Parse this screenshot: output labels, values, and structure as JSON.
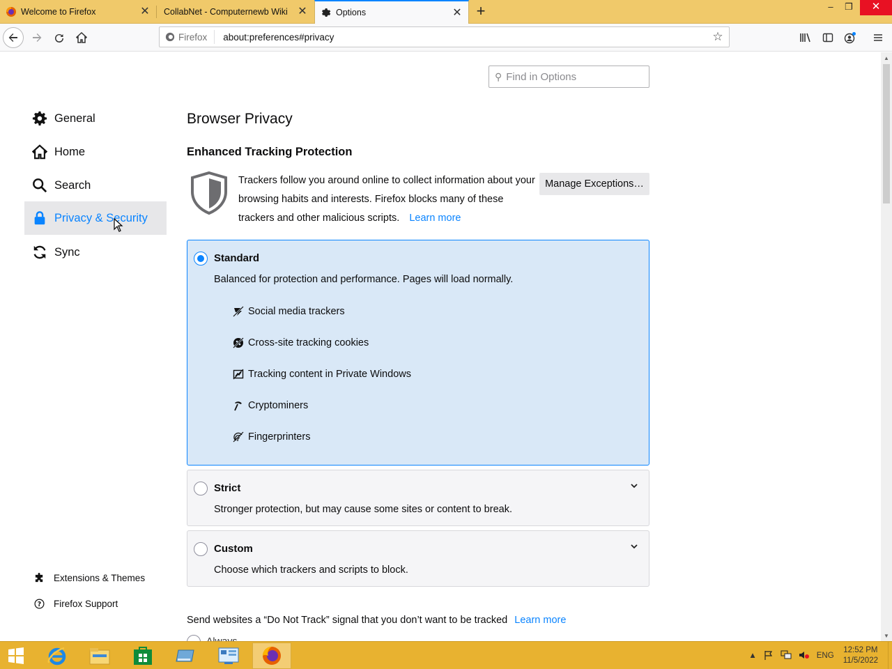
{
  "tabs": [
    {
      "title": "Welcome to Firefox",
      "icon": "firefox-icon"
    },
    {
      "title": "CollabNet - Computernewb Wiki",
      "icon": "none"
    },
    {
      "title": "Options",
      "icon": "gear-icon"
    }
  ],
  "window_controls": {
    "minimize": "–",
    "restore": "❐",
    "close": "✕"
  },
  "navbar": {
    "identity_label": "Firefox",
    "url": "about:preferences#privacy"
  },
  "search": {
    "placeholder": "Find in Options"
  },
  "sidebar": {
    "categories": [
      {
        "label": "General",
        "icon": "gear-icon"
      },
      {
        "label": "Home",
        "icon": "home-icon"
      },
      {
        "label": "Search",
        "icon": "search-icon"
      },
      {
        "label": "Privacy & Security",
        "icon": "lock-icon",
        "selected": true
      },
      {
        "label": "Sync",
        "icon": "sync-icon"
      }
    ],
    "footer": [
      {
        "label": "Extensions & Themes",
        "icon": "puzzle-icon"
      },
      {
        "label": "Firefox Support",
        "icon": "help-icon"
      }
    ]
  },
  "main": {
    "section_title": "Browser Privacy",
    "etp_heading": "Enhanced Tracking Protection",
    "etp_description": "Trackers follow you around online to collect information about your browsing habits and interests. Firefox blocks many of these trackers and other malicious scripts.",
    "learn_more": "Learn more",
    "manage_exceptions": "Manage Exceptions…",
    "options": {
      "standard": {
        "title": "Standard",
        "description": "Balanced for protection and performance. Pages will load normally.",
        "checked": true,
        "trackers": [
          {
            "label": "Social media trackers",
            "icon": "social-tracker-icon"
          },
          {
            "label": "Cross-site tracking cookies",
            "icon": "cookie-icon"
          },
          {
            "label": "Tracking content in Private Windows",
            "icon": "tracking-content-icon"
          },
          {
            "label": "Cryptominers",
            "icon": "cryptominer-icon"
          },
          {
            "label": "Fingerprinters",
            "icon": "fingerprint-icon"
          }
        ]
      },
      "strict": {
        "title": "Strict",
        "description": "Stronger protection, but may cause some sites or content to break.",
        "checked": false
      },
      "custom": {
        "title": "Custom",
        "description": "Choose which trackers and scripts to block.",
        "checked": false
      }
    },
    "dnt_text": "Send websites a “Do Not Track” signal that you don’t want to be tracked",
    "dnt_learn_more": "Learn more",
    "dnt_always": "Always"
  },
  "taskbar": {
    "tray_lang": "ENG",
    "time": "12:52 PM",
    "date": "11/5/2022"
  },
  "colors": {
    "accent": "#0a84ff",
    "tabbar": "#f0c96a",
    "taskbar": "#e8b230",
    "selected_option_bg": "#d9e8f7"
  }
}
